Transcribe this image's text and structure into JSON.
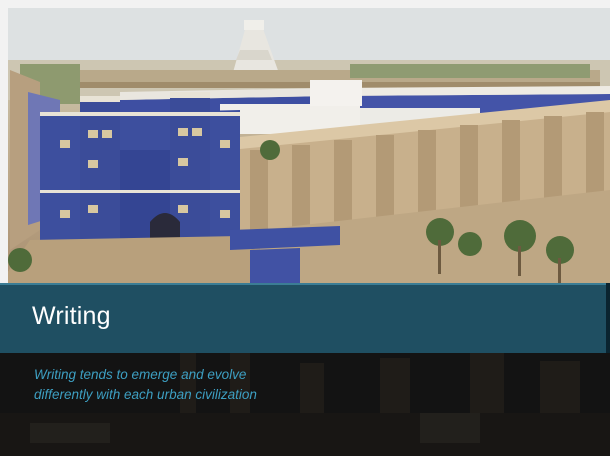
{
  "slide": {
    "title": "Writing",
    "subtitle_lines": [
      "Writing tends to emerge and evolve",
      "differently with each urban civilization"
    ]
  },
  "colors": {
    "title_band": "#1f4f62",
    "title_text": "#ffffff",
    "subtitle_text": "#3d9fc2",
    "background": "#131313",
    "gate_blue": "#3d4f9e"
  }
}
